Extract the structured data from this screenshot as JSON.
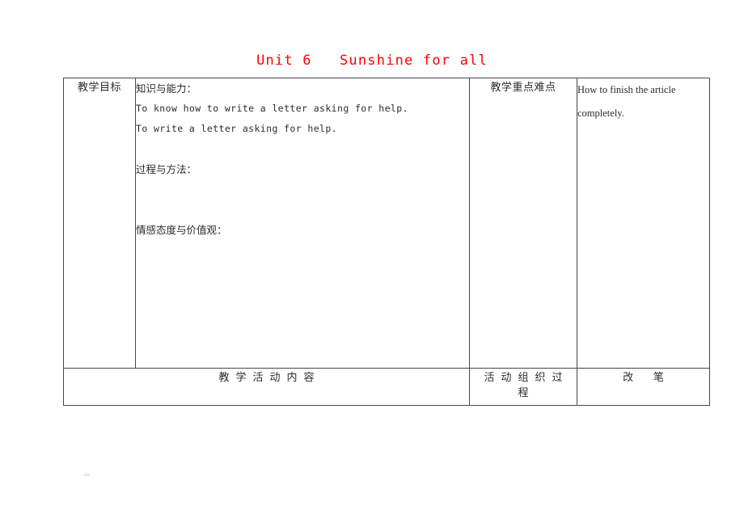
{
  "document": {
    "title": "Unit 6   Sunshine for all",
    "title_color": "#ff0000",
    "border_color": "#4f4350",
    "page_background": "#ffffff"
  },
  "table": {
    "objectives_label": "教学目标",
    "objectives": {
      "heading_knowledge": "知识与能力：",
      "knowledge_line_1": "To know how to write a letter asking for help.",
      "knowledge_line_2": "To write a letter asking for help.",
      "blank_1": " ",
      "heading_process": "过程与方法：",
      "blank_2": " ",
      "blank_3": " ",
      "heading_emotion": "情感态度与价值观："
    },
    "focus_label": "教学重点难点",
    "note": {
      "line_1": "How to finish the article",
      "line_2": "completely."
    },
    "footer": {
      "activity_content": "教学活动内容",
      "activity_process": "活动组织过程",
      "revision": "改      笔"
    }
  }
}
